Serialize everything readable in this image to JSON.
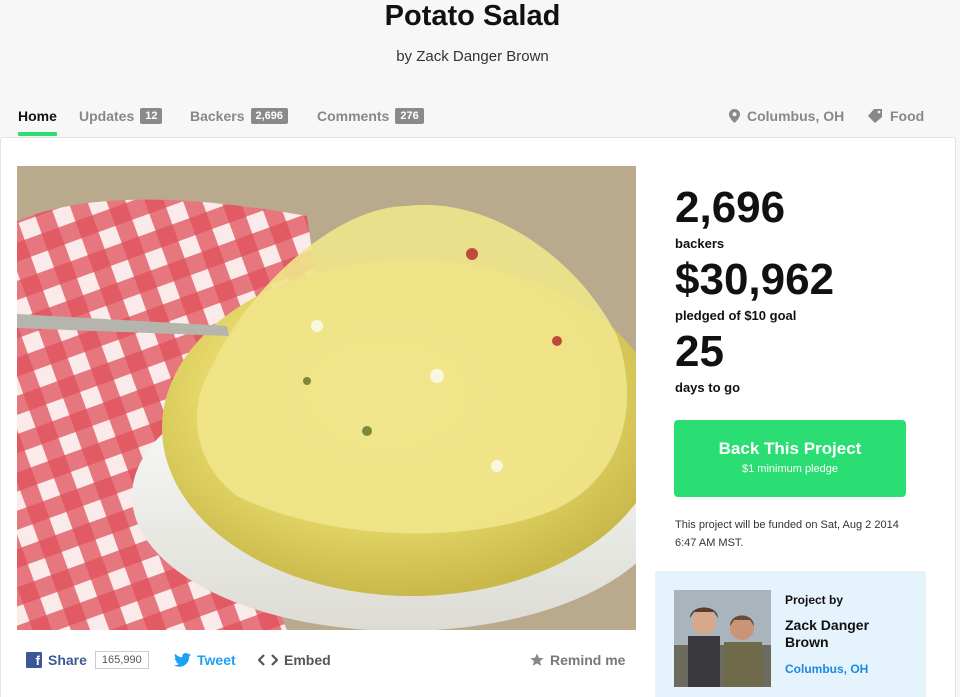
{
  "project": {
    "title": "Potato Salad",
    "byline": "by Zack Danger Brown"
  },
  "nav": {
    "tabs": [
      {
        "label": "Home",
        "count": ""
      },
      {
        "label": "Updates",
        "count": "12"
      },
      {
        "label": "Backers",
        "count": "2,696"
      },
      {
        "label": "Comments",
        "count": "276"
      }
    ],
    "location": "Columbus, OH",
    "category": "Food"
  },
  "stats": {
    "backers_value": "2,696",
    "backers_label": "backers",
    "pledged_value": "$30,962",
    "pledged_label": "pledged of $10 goal",
    "days_value": "25",
    "days_label": "days to go"
  },
  "back_button": {
    "label": "Back This Project",
    "sublabel": "$1 minimum pledge"
  },
  "funding_note": "This project will be funded on Sat, Aug 2 2014 6:47 AM MST.",
  "creator": {
    "heading": "Project by",
    "name": "Zack Danger Brown",
    "location": "Columbus, OH"
  },
  "share": {
    "facebook_label": "Share",
    "facebook_count": "165,990",
    "tweet_label": "Tweet",
    "embed_label": "Embed",
    "remind_label": "Remind me"
  },
  "colors": {
    "accent_green": "#2bde73",
    "link_blue": "#1b8ae4",
    "facebook_blue": "#3b5998",
    "twitter_blue": "#1da1f2",
    "creator_bg": "#e5f3fd"
  },
  "icons": [
    "map-pin-icon",
    "tag-icon",
    "facebook-icon",
    "twitter-icon",
    "embed-code-icon",
    "star-icon"
  ]
}
